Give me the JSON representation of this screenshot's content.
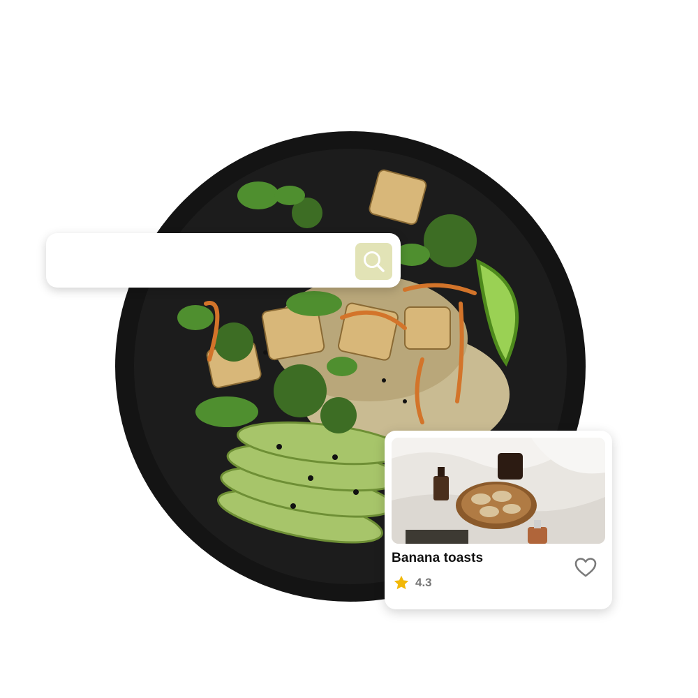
{
  "search": {
    "value": "",
    "placeholder": "",
    "button_icon": "search-icon"
  },
  "recipe_card": {
    "title": "Banana toasts",
    "rating": "4.3",
    "rating_icon": "star-icon",
    "favorite_icon": "heart-outline-icon"
  },
  "colors": {
    "search_button_bg": "#e2e3b6",
    "star": "#f2b807",
    "heart_stroke": "#7a7a7a",
    "rating_text": "#777777"
  }
}
